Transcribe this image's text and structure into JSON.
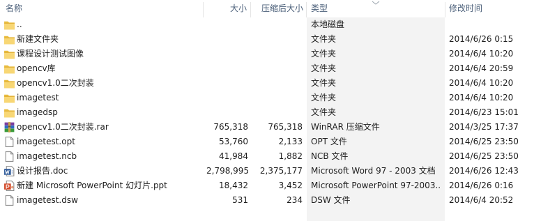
{
  "columns": {
    "name": "名称",
    "size": "大小",
    "compressed": "压缩后大小",
    "type": "类型",
    "modified": "修改时间"
  },
  "sort": {
    "column": "type",
    "icon": "sort-chevron-icon"
  },
  "rows": [
    {
      "icon": "folder-icon",
      "name": "..",
      "size": "",
      "compressed": "",
      "type": "本地磁盘",
      "modified": ""
    },
    {
      "icon": "folder-icon",
      "name": "新建文件夹",
      "size": "",
      "compressed": "",
      "type": "文件夹",
      "modified": "2014/6/26 0:15"
    },
    {
      "icon": "folder-icon",
      "name": "课程设计测试图像",
      "size": "",
      "compressed": "",
      "type": "文件夹",
      "modified": "2014/6/4 10:20"
    },
    {
      "icon": "folder-icon",
      "name": "opencv库",
      "size": "",
      "compressed": "",
      "type": "文件夹",
      "modified": "2014/6/4 20:59"
    },
    {
      "icon": "folder-icon",
      "name": "opencv1.0二次封装",
      "size": "",
      "compressed": "",
      "type": "文件夹",
      "modified": "2014/6/4 10:20"
    },
    {
      "icon": "folder-icon",
      "name": "imagetest",
      "size": "",
      "compressed": "",
      "type": "文件夹",
      "modified": "2014/6/4 10:20"
    },
    {
      "icon": "folder-icon",
      "name": "imagedsp",
      "size": "",
      "compressed": "",
      "type": "文件夹",
      "modified": "2014/6/23 15:01"
    },
    {
      "icon": "winrar-archive-icon",
      "name": "opencv1.0二次封装.rar",
      "size": "765,318",
      "compressed": "765,318",
      "type": "WinRAR 压缩文件",
      "modified": "2014/3/25 17:37"
    },
    {
      "icon": "file-icon",
      "name": "imagetest.opt",
      "size": "53,760",
      "compressed": "2,133",
      "type": "OPT 文件",
      "modified": "2014/6/25 23:50"
    },
    {
      "icon": "file-icon",
      "name": "imagetest.ncb",
      "size": "41,984",
      "compressed": "1,882",
      "type": "NCB 文件",
      "modified": "2014/6/25 23:50"
    },
    {
      "icon": "word-document-icon",
      "name": "设计报告.doc",
      "size": "2,798,995",
      "compressed": "2,375,177",
      "type": "Microsoft Word 97 - 2003 文档",
      "modified": "2014/6/26 12:43"
    },
    {
      "icon": "powerpoint-document-icon",
      "name": "新建 Microsoft PowerPoint 幻灯片.ppt",
      "size": "18,432",
      "compressed": "3,452",
      "type": "Microsoft PowerPoint 97-2003...",
      "modified": "2014/6/26 0:16"
    },
    {
      "icon": "file-icon",
      "name": "imagetest.dsw",
      "size": "531",
      "compressed": "234",
      "type": "DSW 文件",
      "modified": "2014/6/4 20:52"
    }
  ]
}
